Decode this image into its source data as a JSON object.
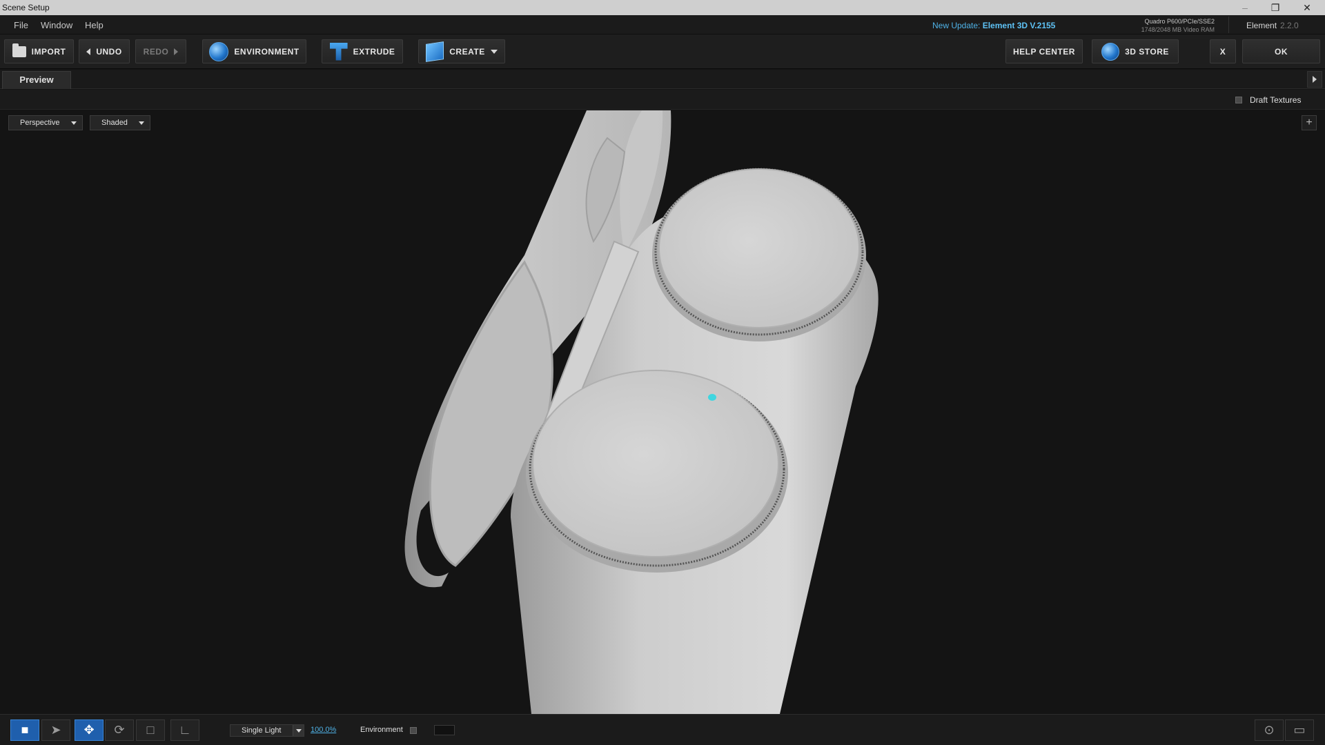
{
  "window": {
    "title": "Scene Setup",
    "controls": [
      "minimize",
      "restore",
      "close"
    ]
  },
  "menubar": {
    "items": [
      "File",
      "Window",
      "Help"
    ],
    "update_prefix": "New Update:",
    "update_link": "Element 3D V.2155",
    "gpu_name": "Quadro P600/PCIe/SSE2",
    "gpu_ram": "1748/2048 MB Video RAM",
    "product": "Element",
    "version": "2.2.0"
  },
  "toolbar": {
    "import": "IMPORT",
    "undo": "UNDO",
    "redo": "REDO",
    "environment": "ENVIRONMENT",
    "extrude": "EXTRUDE",
    "create": "CREATE",
    "help_center": "HELP CENTER",
    "store": "3D STORE",
    "close": "X",
    "ok": "OK"
  },
  "tabs": [
    {
      "label": "Preview",
      "active": true
    }
  ],
  "options": {
    "draft_textures": {
      "label": "Draft Textures",
      "checked": false
    }
  },
  "viewport": {
    "camera": "Perspective",
    "shading": "Shaded",
    "object": "open white charging case with two circular pads",
    "indicator_color": "#3fd6e0"
  },
  "bottombar": {
    "tools": [
      "camera-tool",
      "select-tool",
      "move-tool",
      "rotate-tool",
      "scale-tool",
      "axis-tool"
    ],
    "active_tool": "camera-tool",
    "light": "Single Light",
    "light_intensity": "100.0%",
    "environment_label": "Environment",
    "environment_checked": false
  },
  "colors": {
    "accent": "#4fb3e8",
    "active_tool": "#1f5fad",
    "background": "#141414"
  }
}
